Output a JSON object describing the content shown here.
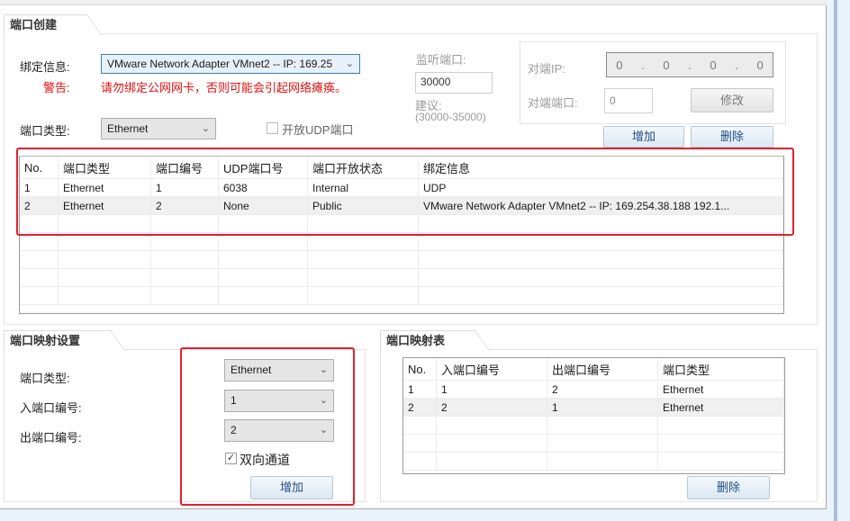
{
  "port_create": {
    "title": "端口创建",
    "bind_label": "绑定信息:",
    "bind_value": "VMware Network Adapter VMnet2 -- IP: 169.25",
    "warning_label": "警告:",
    "warning_text": "请勿绑定公网网卡，否则可能会引起网络瘫痪。",
    "port_type_label": "端口类型:",
    "port_type_value": "Ethernet",
    "udp_checkbox_label": "开放UDP端口",
    "listen_port_label": "监听端口:",
    "listen_port_value": "30000",
    "suggest_label": "建议:",
    "suggest_range": "(30000-35000)",
    "peer_ip_label": "对端IP:",
    "peer_ip_octets": [
      "0",
      "0",
      "0",
      "0"
    ],
    "peer_port_label": "对端端口:",
    "peer_port_value": "0",
    "modify_button": "修改",
    "add_button": "增加",
    "delete_button": "删除",
    "table": {
      "columns": [
        "No.",
        "端口类型",
        "端口编号",
        "UDP端口号",
        "端口开放状态",
        "绑定信息"
      ],
      "rows": [
        [
          "1",
          "Ethernet",
          "1",
          "6038",
          "Internal",
          "UDP"
        ],
        [
          "2",
          "Ethernet",
          "2",
          "None",
          "Public",
          "VMware Network Adapter VMnet2 -- IP: 169.254.38.188 192.1..."
        ]
      ]
    }
  },
  "mapping_settings": {
    "title": "端口映射设置",
    "port_type_label": "端口类型:",
    "port_type_value": "Ethernet",
    "in_port_label": "入端口编号:",
    "in_port_value": "1",
    "out_port_label": "出端口编号:",
    "out_port_value": "2",
    "bidirectional_label": "双向通道",
    "bidirectional_checked": true,
    "add_button": "增加"
  },
  "mapping_table": {
    "title": "端口映射表",
    "columns": [
      "No.",
      "入端口编号",
      "出端口编号",
      "端口类型"
    ],
    "rows": [
      [
        "1",
        "1",
        "2",
        "Ethernet"
      ],
      [
        "2",
        "2",
        "1",
        "Ethernet"
      ]
    ],
    "delete_button": "删除"
  },
  "colors": {
    "highlight": "#e02030",
    "warning": "#e01010",
    "button_text": "#1f4e87"
  }
}
